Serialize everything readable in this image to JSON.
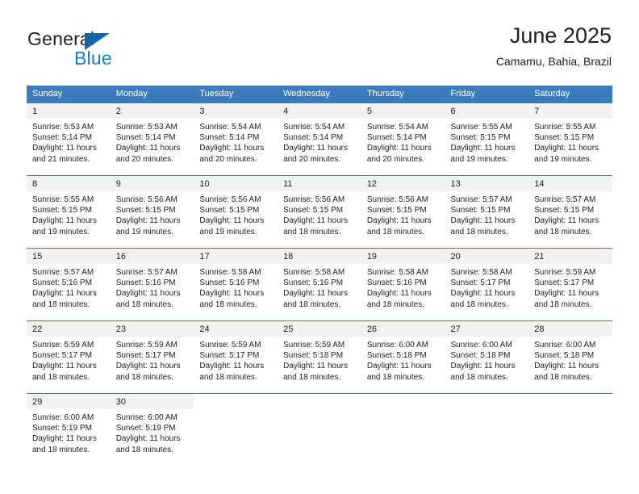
{
  "brand": {
    "word_one": "General",
    "word_two": "Blue",
    "triangle_icon": "blue-triangle-logo",
    "accent_color": "#1464aa",
    "blue_text_color": "#1a7fd4"
  },
  "header": {
    "title": "June 2025",
    "subtitle": "Camamu, Bahia, Brazil"
  },
  "theme": {
    "header_row_bg": "#3a7cbe",
    "daynum_bg": "#f2f2f2",
    "text_color": "#231f20",
    "page_bg": "#ffffff"
  },
  "weekdays": [
    "Sunday",
    "Monday",
    "Tuesday",
    "Wednesday",
    "Thursday",
    "Friday",
    "Saturday"
  ],
  "weeks": [
    [
      {
        "day": "1",
        "sunrise": "Sunrise: 5:53 AM",
        "sunset": "Sunset: 5:14 PM",
        "daylight_line1": "Daylight: 11 hours",
        "daylight_line2": "and 21 minutes."
      },
      {
        "day": "2",
        "sunrise": "Sunrise: 5:53 AM",
        "sunset": "Sunset: 5:14 PM",
        "daylight_line1": "Daylight: 11 hours",
        "daylight_line2": "and 20 minutes."
      },
      {
        "day": "3",
        "sunrise": "Sunrise: 5:54 AM",
        "sunset": "Sunset: 5:14 PM",
        "daylight_line1": "Daylight: 11 hours",
        "daylight_line2": "and 20 minutes."
      },
      {
        "day": "4",
        "sunrise": "Sunrise: 5:54 AM",
        "sunset": "Sunset: 5:14 PM",
        "daylight_line1": "Daylight: 11 hours",
        "daylight_line2": "and 20 minutes."
      },
      {
        "day": "5",
        "sunrise": "Sunrise: 5:54 AM",
        "sunset": "Sunset: 5:14 PM",
        "daylight_line1": "Daylight: 11 hours",
        "daylight_line2": "and 20 minutes."
      },
      {
        "day": "6",
        "sunrise": "Sunrise: 5:55 AM",
        "sunset": "Sunset: 5:15 PM",
        "daylight_line1": "Daylight: 11 hours",
        "daylight_line2": "and 19 minutes."
      },
      {
        "day": "7",
        "sunrise": "Sunrise: 5:55 AM",
        "sunset": "Sunset: 5:15 PM",
        "daylight_line1": "Daylight: 11 hours",
        "daylight_line2": "and 19 minutes."
      }
    ],
    [
      {
        "day": "8",
        "sunrise": "Sunrise: 5:55 AM",
        "sunset": "Sunset: 5:15 PM",
        "daylight_line1": "Daylight: 11 hours",
        "daylight_line2": "and 19 minutes."
      },
      {
        "day": "9",
        "sunrise": "Sunrise: 5:56 AM",
        "sunset": "Sunset: 5:15 PM",
        "daylight_line1": "Daylight: 11 hours",
        "daylight_line2": "and 19 minutes."
      },
      {
        "day": "10",
        "sunrise": "Sunrise: 5:56 AM",
        "sunset": "Sunset: 5:15 PM",
        "daylight_line1": "Daylight: 11 hours",
        "daylight_line2": "and 19 minutes."
      },
      {
        "day": "11",
        "sunrise": "Sunrise: 5:56 AM",
        "sunset": "Sunset: 5:15 PM",
        "daylight_line1": "Daylight: 11 hours",
        "daylight_line2": "and 18 minutes."
      },
      {
        "day": "12",
        "sunrise": "Sunrise: 5:56 AM",
        "sunset": "Sunset: 5:15 PM",
        "daylight_line1": "Daylight: 11 hours",
        "daylight_line2": "and 18 minutes."
      },
      {
        "day": "13",
        "sunrise": "Sunrise: 5:57 AM",
        "sunset": "Sunset: 5:15 PM",
        "daylight_line1": "Daylight: 11 hours",
        "daylight_line2": "and 18 minutes."
      },
      {
        "day": "14",
        "sunrise": "Sunrise: 5:57 AM",
        "sunset": "Sunset: 5:15 PM",
        "daylight_line1": "Daylight: 11 hours",
        "daylight_line2": "and 18 minutes."
      }
    ],
    [
      {
        "day": "15",
        "sunrise": "Sunrise: 5:57 AM",
        "sunset": "Sunset: 5:16 PM",
        "daylight_line1": "Daylight: 11 hours",
        "daylight_line2": "and 18 minutes."
      },
      {
        "day": "16",
        "sunrise": "Sunrise: 5:57 AM",
        "sunset": "Sunset: 5:16 PM",
        "daylight_line1": "Daylight: 11 hours",
        "daylight_line2": "and 18 minutes."
      },
      {
        "day": "17",
        "sunrise": "Sunrise: 5:58 AM",
        "sunset": "Sunset: 5:16 PM",
        "daylight_line1": "Daylight: 11 hours",
        "daylight_line2": "and 18 minutes."
      },
      {
        "day": "18",
        "sunrise": "Sunrise: 5:58 AM",
        "sunset": "Sunset: 5:16 PM",
        "daylight_line1": "Daylight: 11 hours",
        "daylight_line2": "and 18 minutes."
      },
      {
        "day": "19",
        "sunrise": "Sunrise: 5:58 AM",
        "sunset": "Sunset: 5:16 PM",
        "daylight_line1": "Daylight: 11 hours",
        "daylight_line2": "and 18 minutes."
      },
      {
        "day": "20",
        "sunrise": "Sunrise: 5:58 AM",
        "sunset": "Sunset: 5:17 PM",
        "daylight_line1": "Daylight: 11 hours",
        "daylight_line2": "and 18 minutes."
      },
      {
        "day": "21",
        "sunrise": "Sunrise: 5:59 AM",
        "sunset": "Sunset: 5:17 PM",
        "daylight_line1": "Daylight: 11 hours",
        "daylight_line2": "and 18 minutes."
      }
    ],
    [
      {
        "day": "22",
        "sunrise": "Sunrise: 5:59 AM",
        "sunset": "Sunset: 5:17 PM",
        "daylight_line1": "Daylight: 11 hours",
        "daylight_line2": "and 18 minutes."
      },
      {
        "day": "23",
        "sunrise": "Sunrise: 5:59 AM",
        "sunset": "Sunset: 5:17 PM",
        "daylight_line1": "Daylight: 11 hours",
        "daylight_line2": "and 18 minutes."
      },
      {
        "day": "24",
        "sunrise": "Sunrise: 5:59 AM",
        "sunset": "Sunset: 5:17 PM",
        "daylight_line1": "Daylight: 11 hours",
        "daylight_line2": "and 18 minutes."
      },
      {
        "day": "25",
        "sunrise": "Sunrise: 5:59 AM",
        "sunset": "Sunset: 5:18 PM",
        "daylight_line1": "Daylight: 11 hours",
        "daylight_line2": "and 18 minutes."
      },
      {
        "day": "26",
        "sunrise": "Sunrise: 6:00 AM",
        "sunset": "Sunset: 5:18 PM",
        "daylight_line1": "Daylight: 11 hours",
        "daylight_line2": "and 18 minutes."
      },
      {
        "day": "27",
        "sunrise": "Sunrise: 6:00 AM",
        "sunset": "Sunset: 5:18 PM",
        "daylight_line1": "Daylight: 11 hours",
        "daylight_line2": "and 18 minutes."
      },
      {
        "day": "28",
        "sunrise": "Sunrise: 6:00 AM",
        "sunset": "Sunset: 5:18 PM",
        "daylight_line1": "Daylight: 11 hours",
        "daylight_line2": "and 18 minutes."
      }
    ],
    [
      {
        "day": "29",
        "sunrise": "Sunrise: 6:00 AM",
        "sunset": "Sunset: 5:19 PM",
        "daylight_line1": "Daylight: 11 hours",
        "daylight_line2": "and 18 minutes."
      },
      {
        "day": "30",
        "sunrise": "Sunrise: 6:00 AM",
        "sunset": "Sunset: 5:19 PM",
        "daylight_line1": "Daylight: 11 hours",
        "daylight_line2": "and 18 minutes."
      },
      null,
      null,
      null,
      null,
      null
    ]
  ]
}
